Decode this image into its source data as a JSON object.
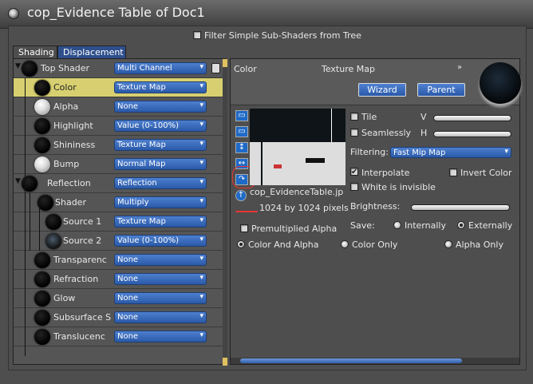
{
  "window": {
    "title": "cop_Evidence Table of Doc1"
  },
  "filter": {
    "label": "Filter Simple Sub-Shaders from Tree",
    "checked": false
  },
  "tabs": [
    {
      "label": "Shading",
      "active": true
    },
    {
      "label": "Displacement",
      "active": false
    }
  ],
  "tree": [
    {
      "label": "Top Shader",
      "value": "Multi Channel",
      "ball": "black"
    },
    {
      "label": "Color",
      "value": "Texture Map",
      "ball": "black",
      "selected": true
    },
    {
      "label": "Alpha",
      "value": "None",
      "ball": "white"
    },
    {
      "label": "Highlight",
      "value": "Value (0-100%)",
      "ball": "black"
    },
    {
      "label": "Shininess",
      "value": "Texture Map",
      "ball": "black"
    },
    {
      "label": "Bump",
      "value": "Normal Map",
      "ball": "white"
    },
    {
      "label": "Reflection",
      "value": "Reflection",
      "ball": "black"
    },
    {
      "label": "Shader",
      "value": "Multiply",
      "ball": "black"
    },
    {
      "label": "Source 1",
      "value": "Texture Map",
      "ball": "black"
    },
    {
      "label": "Source 2",
      "value": "Value (0-100%)",
      "ball": "dark"
    },
    {
      "label": "Transparenc",
      "value": "None",
      "ball": "black"
    },
    {
      "label": "Refraction",
      "value": "None",
      "ball": "black"
    },
    {
      "label": "Glow",
      "value": "None",
      "ball": "black"
    },
    {
      "label": "Subsurface S",
      "value": "None",
      "ball": "black"
    },
    {
      "label": "Translucenc",
      "value": "None",
      "ball": "black"
    }
  ],
  "right": {
    "channel": "Color",
    "type": "Texture Map",
    "wizard": "Wizard",
    "parent": "Parent",
    "filename": "cop_EvidenceTable.jp",
    "dimensions": "1024 by 1024 pixels",
    "tile": "Tile",
    "seamlessly": "Seamlessly",
    "v_label": "V",
    "h_label": "H",
    "filtering_label": "Filtering:",
    "filtering_value": "Fast Mip Map",
    "interpolate": "Interpolate",
    "invert_color": "Invert Color",
    "white_invisible": "White is invisible",
    "brightness": "Brightness:",
    "save_label": "Save:",
    "internally": "Internally",
    "externally": "Externally",
    "premultiplied": "Premultiplied Alpha",
    "color_and_alpha": "Color And Alpha",
    "color_only": "Color Only",
    "alpha_only": "Alpha Only"
  },
  "icons": [
    "folder-open-icon",
    "folder-icon",
    "vertical-flip-icon",
    "horizontal-flip-icon",
    "rotate-icon",
    "up-arrow-icon",
    "trash-icon",
    "close-icon",
    "chevron-down-icon"
  ]
}
